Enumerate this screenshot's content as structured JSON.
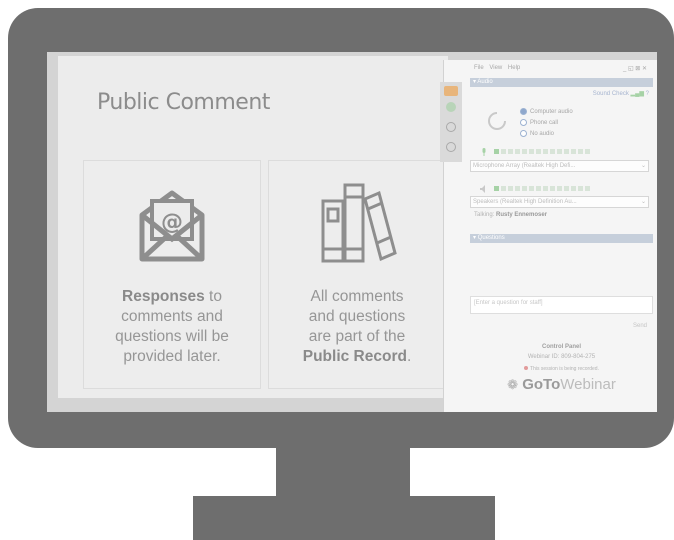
{
  "slide": {
    "title": "Public Comment",
    "card_left": {
      "icon": "envelope-at-icon",
      "text_bold": "Responses",
      "text_rest_1": " to",
      "text_rest_2": "comments and",
      "text_rest_3": "questions will be",
      "text_rest_4": "provided later."
    },
    "card_right": {
      "icon": "books-icon",
      "line1": "All comments",
      "line2": "and questions",
      "line3": "are part of the",
      "text_bold": "Public Record",
      "text_end": "."
    }
  },
  "gtw": {
    "menu": [
      "File",
      "View",
      "Help"
    ],
    "window_controls": "_ ◱ ⊠ ✕",
    "audio_header": "Audio",
    "sound_check": "Sound Check",
    "audio_options": [
      "Computer audio",
      "Phone call",
      "No audio"
    ],
    "selected_audio": "Computer audio",
    "microphone": "Microphone Array (Realtek High Defi...",
    "speakers": "Speakers (Realtek High Definition Au...",
    "talking_label": "Talking:",
    "talking_name": "Rusty Ennemoser",
    "questions_header": "Questions",
    "question_placeholder": "[Enter a question for staff]",
    "send": "Send",
    "control_panel": "Control Panel",
    "webinar_id": "Webinar ID: 809-804-275",
    "recording": "This session is being recorded.",
    "brand_goto": "GoTo",
    "brand_webinar": "Webinar"
  },
  "colors": {
    "bezel": "#6e6e6e",
    "slide_bg": "#ececec",
    "text_gray": "#969696"
  }
}
